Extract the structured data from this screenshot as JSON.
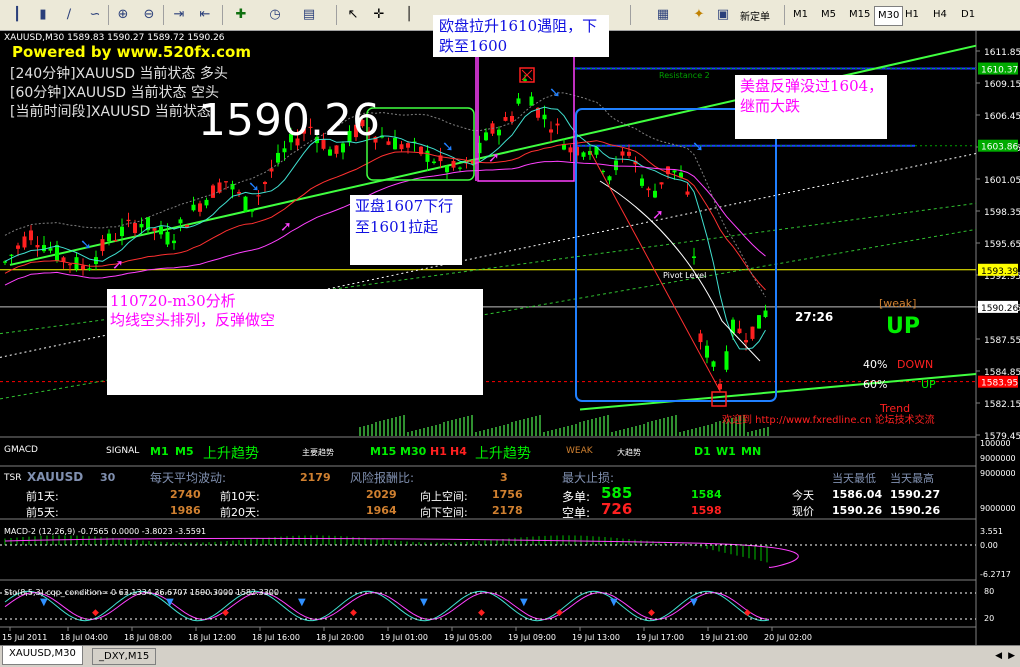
{
  "toolbar": {
    "new_order_label": "新定单",
    "timeframes": [
      "M1",
      "M5",
      "M15",
      "M30",
      "H1",
      "H4",
      "D1"
    ],
    "active_timeframe": "M30"
  },
  "chart": {
    "symbol_line": "XAUUSD,M30  1589.83 1590.27 1589.72 1590.26",
    "powered_by": "Powered by www.520fx.com",
    "status_240": "[240分钟]XAUUSD 当前状态 多头",
    "status_60": "[60分钟]XAUUSD 当前状态 空头",
    "status_now": "[当前时间段]XAUUSD 当前状态",
    "big_price": "1590.26",
    "countdown": "27:26",
    "weak_label": "[weak]",
    "up_label": "UP",
    "pct_down": "40%",
    "down_label": "DOWN",
    "pct_up": "60%",
    "up_small": "UP",
    "trend_label": "Trend",
    "resistance_label": "Resistance 2",
    "pivot_label": "Pivot Level",
    "footer_link": "欢迎到 http://www.fxredline.cn 论坛技术交流",
    "annotations": {
      "europe": "欧盘拉升1610遇阻，下跌至1600",
      "us": "美盘反弹没过1604，继而大跌",
      "asia": "亚盘1607下行至1601拉起",
      "analysis_title": "110720-m30分析",
      "analysis_body": "均线空头排列，反弹做空"
    },
    "price_axis": [
      "1611.85",
      "1609.15",
      "1606.45",
      "1603.75",
      "1601.05",
      "1598.35",
      "1595.65",
      "1592.95",
      "1590.25",
      "1587.55",
      "1584.85",
      "1582.15",
      "1579.45"
    ],
    "price_tags": [
      {
        "label": "1610.37",
        "color": "#00aa00",
        "y": 1610.37
      },
      {
        "label": "1603.86",
        "color": "#00aa00",
        "y": 1603.86
      },
      {
        "label": "1593.39",
        "color": "#ffff00",
        "y": 1593.39
      },
      {
        "label": "1590.26",
        "color": "#ffffff",
        "y": 1590.26
      },
      {
        "label": "1583.95",
        "color": "#ff0000",
        "y": 1583.95
      }
    ],
    "time_axis": [
      "15 Jul 2011",
      "18 Jul 04:00",
      "18 Jul 08:00",
      "18 Jul 12:00",
      "18 Jul 16:00",
      "18 Jul 20:00",
      "19 Jul 01:00",
      "19 Jul 05:00",
      "19 Jul 09:00",
      "19 Jul 13:00",
      "19 Jul 17:00",
      "19 Jul 21:00",
      "20 Jul 02:00"
    ]
  },
  "gmacd": {
    "title": "GMACD",
    "signal": "SIGNAL",
    "m1": "M1",
    "m5": "M5",
    "trend_left": "上升趋势",
    "main_trend": "主要趋势",
    "m15": "M15",
    "m30": "M30",
    "h1": "H1",
    "h4": "H4",
    "trend_mid": "上升趋势",
    "weak": "WEAK",
    "big_trend": "大趋势",
    "d1": "D1",
    "w1": "W1",
    "mn": "MN",
    "axis": [
      "100000",
      "9000000"
    ]
  },
  "tsr": {
    "title": "TSR",
    "symbol": "XAUUSD",
    "period": "30",
    "avg_label": "每天平均波动:",
    "avg_value": "2179",
    "risk_label": "风险报酬比:",
    "risk_value": "3",
    "maxloss_label": "最大止损:",
    "low_label": "当天最低",
    "high_label": "当天最高",
    "d1_label": "前1天:",
    "d1_value": "2740",
    "d10_label": "前10天:",
    "d10_value": "2029",
    "up_label": "向上空间:",
    "up_value": "1756",
    "d5_label": "前5天:",
    "d5_value": "1986",
    "d20_label": "前20天:",
    "d20_value": "1964",
    "down_label": "向下空间:",
    "down_value": "2178",
    "long_label": "多单:",
    "long_value": "585",
    "long_value2": "1584",
    "short_label": "空单:",
    "short_value": "726",
    "short_value2": "1598",
    "today_label": "今天",
    "today_low": "1586.04",
    "today_high": "1590.27",
    "now_label": "现价",
    "now_low": "1590.26",
    "now_high": "1590.26",
    "axis": [
      "9000000",
      "9000000"
    ]
  },
  "macd": {
    "title": "MACD-2 (12,26,9) -0.7565 0.0000 -3.8023 -3.5591",
    "axis": [
      "3.551",
      "0.00",
      "-6.2717"
    ]
  },
  "stoch": {
    "title": "Sto(8,5,3) cqp_condition= 0  63.1334 36.6707 1590.3000 1582.3300",
    "axis": [
      "80",
      "20"
    ]
  },
  "tabs": [
    "XAUUSD,M30",
    "_DXY,M15"
  ]
}
